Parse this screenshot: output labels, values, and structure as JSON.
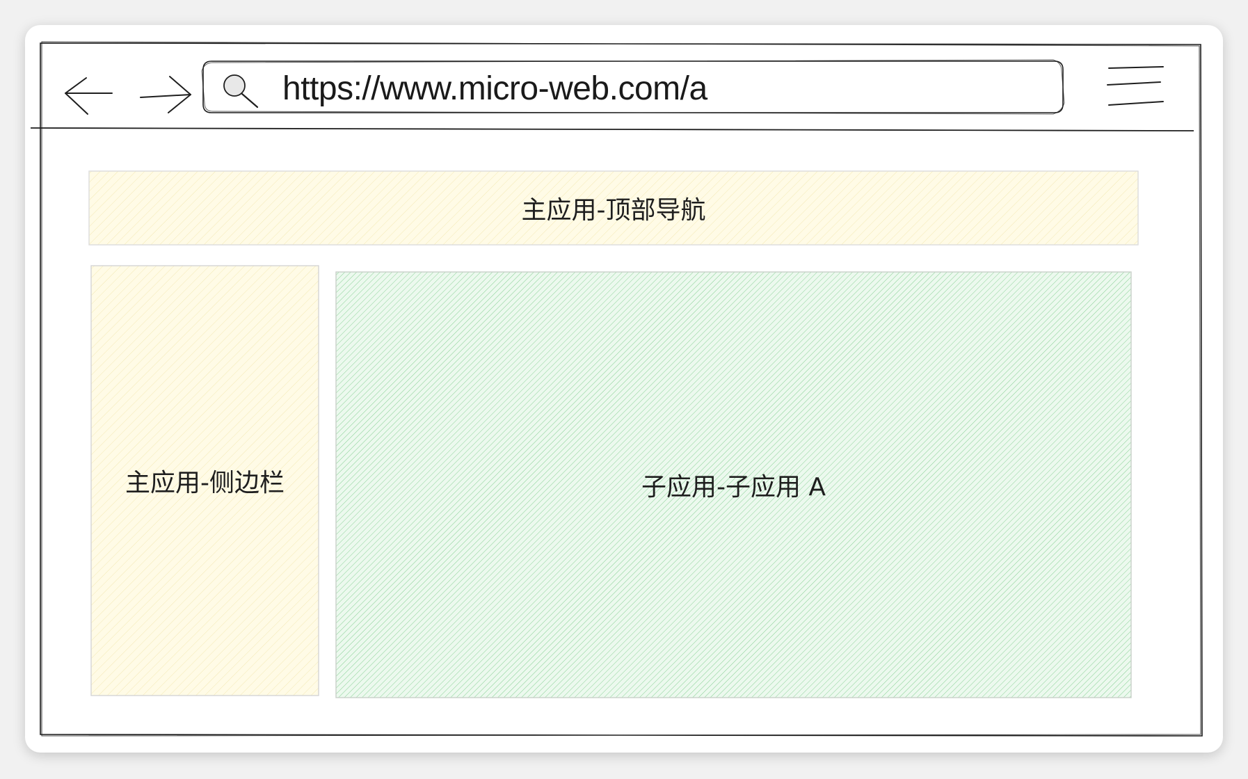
{
  "browser": {
    "url": "https://www.micro-web.com/a",
    "back_icon": "arrow-left-icon",
    "forward_icon": "arrow-right-icon",
    "search_icon": "search-icon",
    "menu_icon": "hamburger-menu-icon"
  },
  "layout": {
    "top_nav": {
      "label": "主应用-顶部导航",
      "fill": "#fff9db"
    },
    "sidebar": {
      "label": "主应用-侧边栏",
      "fill": "#fff9db"
    },
    "content": {
      "label": "子应用-子应用 A",
      "fill": "#b2f2bb",
      "hatch": "#40c057"
    }
  }
}
